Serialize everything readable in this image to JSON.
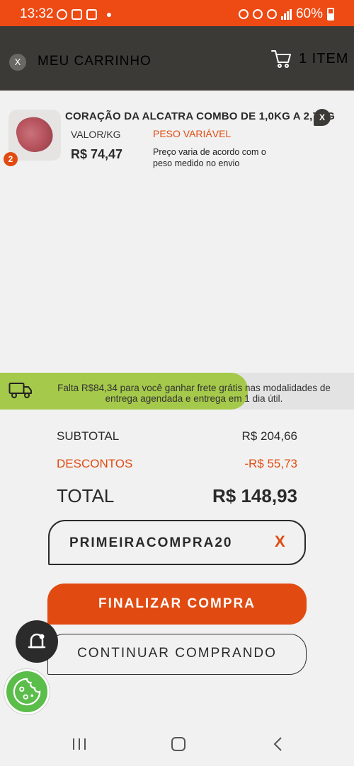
{
  "status_bar": {
    "time": "13:32",
    "battery": "60%"
  },
  "header": {
    "close_label": "X",
    "title": "MEU CARRINHO",
    "item_count": "1 ITEM"
  },
  "cart_item": {
    "quantity": "2",
    "name": "CORAÇÃO DA ALCATRA COMBO DE 1,0KG A 2,7KG",
    "remove_label": "X",
    "unit_label": "VALOR/KG",
    "price": "R$ 74,47",
    "variable_weight_label": "PESO VARIÁVEL",
    "variable_weight_note": "Preço varia de acordo com o peso medido no envio"
  },
  "shipping": {
    "message": "Falta R$84,34 para você ganhar frete grátis nas modalidades de entrega agendada e entrega em 1 dia útil.",
    "progress": 0.7
  },
  "summary": {
    "subtotal_label": "SUBTOTAL",
    "subtotal_value": "R$ 204,66",
    "discounts_label": "DESCONTOS",
    "discounts_value": "-R$ 55,73",
    "total_label": "TOTAL",
    "total_value": "R$ 148,93"
  },
  "coupon": {
    "code": "PRIMEIRACOMPRA20",
    "remove_label": "X"
  },
  "actions": {
    "checkout": "FINALIZAR COMPRA",
    "continue": "CONTINUAR COMPRANDO"
  },
  "colors": {
    "brand": "#ee4a14",
    "accent": "#e14a10",
    "header": "#3c3a36",
    "progress": "#a5c94a"
  }
}
